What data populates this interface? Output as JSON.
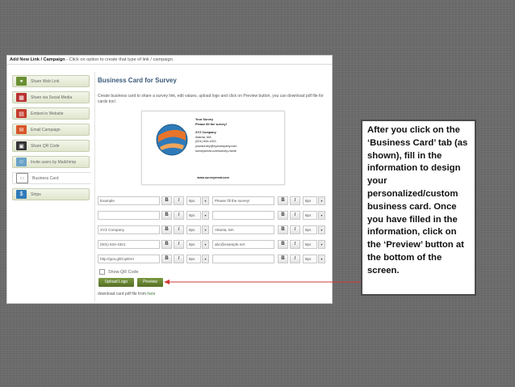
{
  "header": {
    "title": "Add New Link / Campaign",
    "subtitle": " - Click on option to create that type of link / campaign."
  },
  "sidebar": {
    "items": [
      {
        "label": "Share Web Link",
        "icon": "link-icon",
        "color": "#6a8f32",
        "active": false
      },
      {
        "label": "Share via Social Media",
        "icon": "social-media-icon",
        "color": "#b8312f",
        "active": false
      },
      {
        "label": "Embed in Website",
        "icon": "embed-icon",
        "color": "#c43b2a",
        "active": false
      },
      {
        "label": "Email Campaign",
        "icon": "envelope-icon",
        "color": "#d8562a",
        "active": false
      },
      {
        "label": "Share QR Code",
        "icon": "qr-code-icon",
        "color": "#333333",
        "active": false
      },
      {
        "label": "Invite users by Mailchimp",
        "icon": "mailchimp-icon",
        "color": "#6aa2c8",
        "active": false
      },
      {
        "label": "Business Card",
        "icon": "business-card-icon",
        "color": "#888888",
        "active": true
      },
      {
        "label": "Strips",
        "icon": "dollar-icon",
        "color": "#2f7ab8",
        "active": false
      }
    ]
  },
  "main": {
    "title": "Business Card for Survey",
    "description": "Create business card to share a survey link, edit values, upload logo and click on Preview button, you can download pdf file for cards too!."
  },
  "card": {
    "title": "Your Survey",
    "subtitle": "Please fill the survey!",
    "company": "XYZ Company",
    "address": "Atlanta, MA",
    "phone": "(001) 634-4321",
    "email": "yoursurvey@xyzcompany.com",
    "survey": "surveymeat.com/survey-name",
    "url": "www.surveymeat.com"
  },
  "fields": {
    "font_size": "8px",
    "left": [
      "Example",
      "",
      "XYZ Company",
      "(001) 634-4321",
      "http://goo.gl/tCq8OH"
    ],
    "right": [
      "Please fill the survey!",
      "",
      "Atlanta, MA",
      "abc@example.net",
      ""
    ]
  },
  "toolbar": {
    "bold": "B",
    "italic": "I",
    "dropdown": "▾"
  },
  "options": {
    "show_qr_label": "Show QR Code"
  },
  "buttons": {
    "upload_logo": "Upload Logo",
    "preview": "Preview"
  },
  "footer": {
    "text": "download card pdf file from ",
    "link": "here"
  },
  "callout": {
    "text": "After you click on the ‘Business Card’ tab (as shown), fill in the information to design your personalized/custom business card. Once you have filled in the information, click on the ‘Preview’ button at the bottom of the screen."
  },
  "colors": {
    "accent_green": "#6a8f32",
    "title_blue": "#3a5a7a",
    "arrow_red": "#d23a3a"
  }
}
